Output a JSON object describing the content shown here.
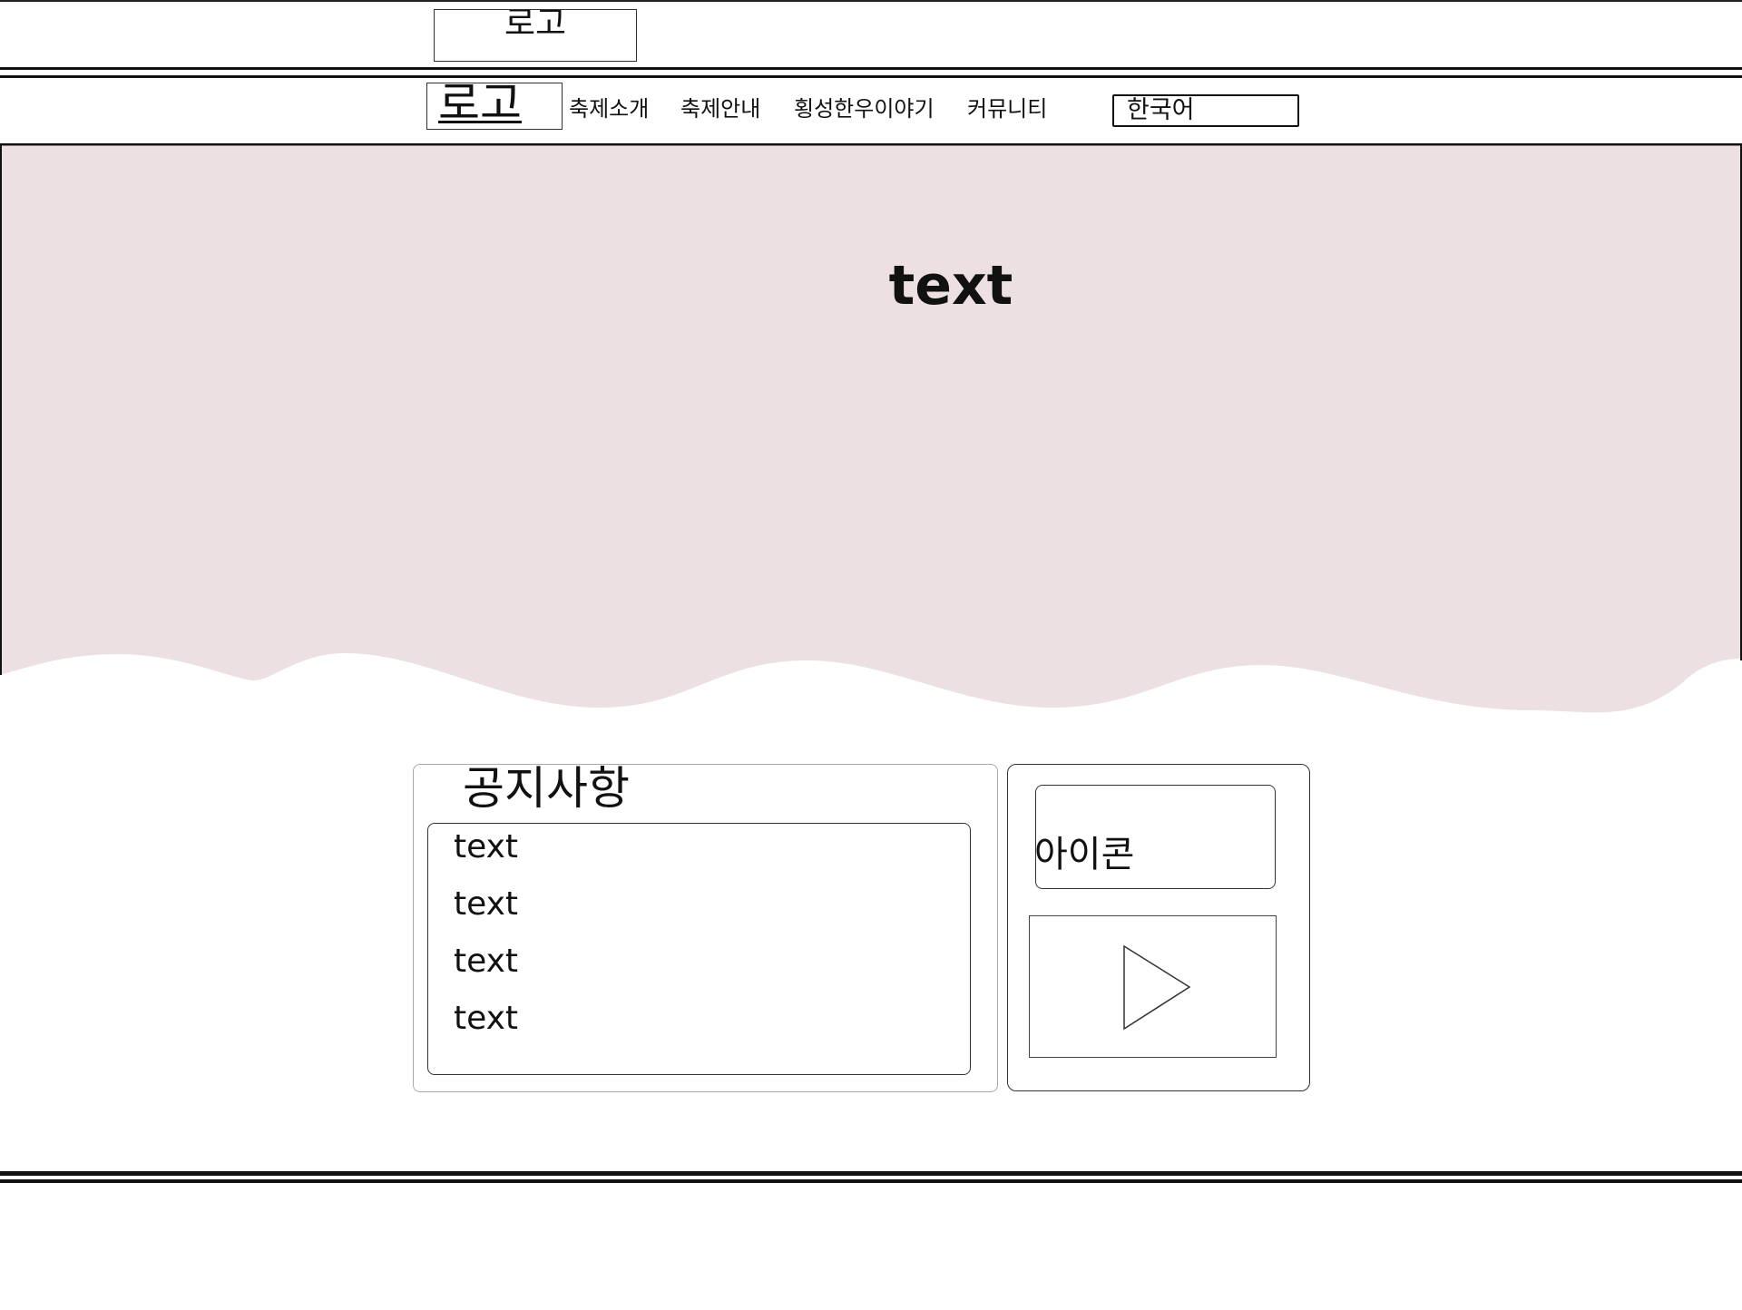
{
  "top_bar": {
    "logo": "로고"
  },
  "nav": {
    "logo": "로고",
    "items": [
      "축제소개",
      "축제안내",
      "횡성한우이야기",
      "커뮤니티"
    ],
    "language": "한국어"
  },
  "hero": {
    "title": "text",
    "background_color": "#ece0e3"
  },
  "notice": {
    "title": "공지사항",
    "items": [
      "text",
      "text",
      "text",
      "text"
    ]
  },
  "side_panel": {
    "icon_label": "아이콘",
    "video_icon": "play-icon"
  }
}
